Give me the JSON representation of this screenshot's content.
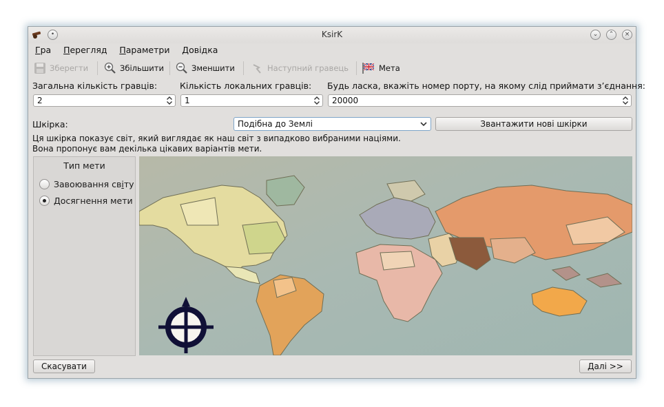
{
  "window": {
    "title": "KsirK"
  },
  "menu": [
    {
      "accel": "Г",
      "rest": "ра"
    },
    {
      "accel": "П",
      "rest": "ерегляд"
    },
    {
      "accel": "П",
      "rest": "араметри"
    },
    {
      "accel": "Д",
      "rest": "овідка"
    }
  ],
  "toolbar": {
    "save": "Зберегти",
    "zoom_in": "Збільшити",
    "zoom_out": "Зменшити",
    "next_player": "Наступний гравець",
    "goal": "Мета"
  },
  "settings": {
    "total_players_label": "Загальна кількість гравців:",
    "total_players_value": "2",
    "local_players_label": "Кількість локальних гравців:",
    "local_players_value": "1",
    "port_label": "Будь ласка, вкажіть номер порту, на якому слід приймати з’єднання:",
    "port_value": "20000"
  },
  "skin": {
    "label": "Шкірка:",
    "selected": "Подібна до Землі",
    "download_button": "Звантажити нові шкірки",
    "description_line1": "Ця шкірка показує світ, який виглядає як наш світ з випадково вибраними націями.",
    "description_line2": "Вона пропонує вам декілька цікавих варіантів мети."
  },
  "goal_type": {
    "title": "Тип мети",
    "option_conquest": {
      "pre": "Завоювання св",
      "accel": "і",
      "post": "ту"
    },
    "option_goal": "Досягнення мети",
    "selected": "option_goal"
  },
  "buttons": {
    "cancel": "Скасувати",
    "next": "Далі >>"
  }
}
